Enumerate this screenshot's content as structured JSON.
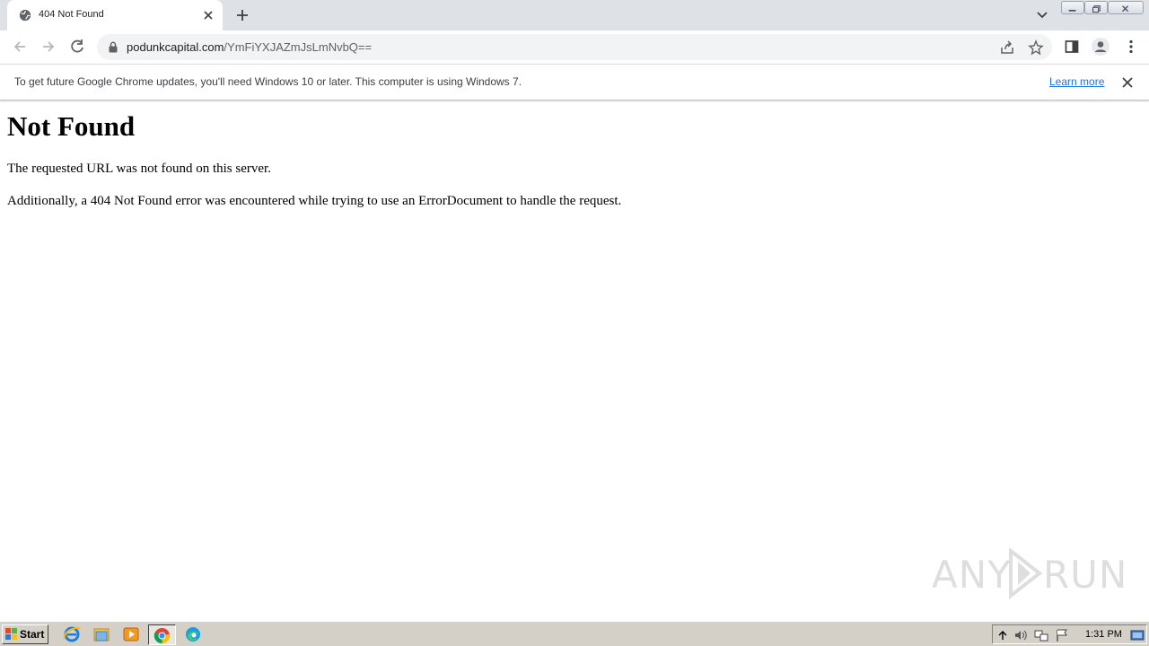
{
  "browser": {
    "tab": {
      "title": "404 Not Found"
    },
    "address": {
      "host": "podunkcapital.com",
      "path": "/YmFiYXJAZmJsLmNvbQ=="
    }
  },
  "infobar": {
    "message": "To get future Google Chrome updates, you'll need Windows 10 or later. This computer is using Windows 7.",
    "link_label": "Learn more"
  },
  "page": {
    "heading": "Not Found",
    "paragraph1": "The requested URL was not found on this server.",
    "paragraph2": "Additionally, a 404 Not Found error was encountered while trying to use an ErrorDocument to handle the request."
  },
  "watermark": {
    "left_text": "ANY",
    "right_text": "RUN"
  },
  "taskbar": {
    "start_label": "Start",
    "clock": "1:31 PM",
    "pinned_apps": [
      "internet-explorer-icon",
      "file-explorer-icon",
      "media-player-icon",
      "chrome-icon",
      "edge-icon"
    ]
  },
  "colors": {
    "link": "#1a73e8",
    "tabstrip": "#dee1e6",
    "taskbar": "#d4d0c8"
  }
}
